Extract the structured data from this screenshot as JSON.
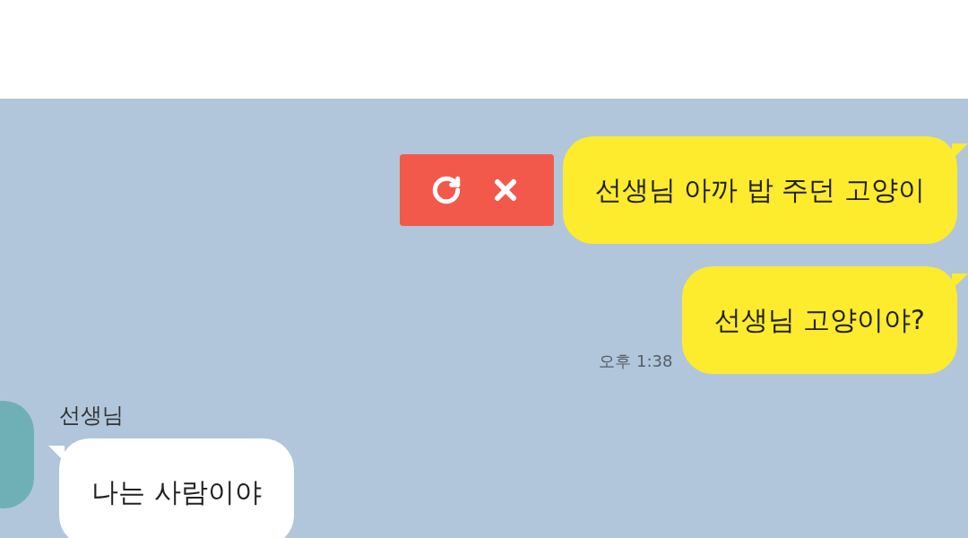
{
  "chat": {
    "messages": [
      {
        "kind": "sent",
        "text": "선생님 아까 밥 주던 고양이",
        "failed": true
      },
      {
        "kind": "sent",
        "text": "선생님 고양이야?",
        "time": "오후 1:38",
        "failed": false
      },
      {
        "kind": "received",
        "sender": "선생님",
        "text": "나는 사람이야"
      }
    ]
  }
}
